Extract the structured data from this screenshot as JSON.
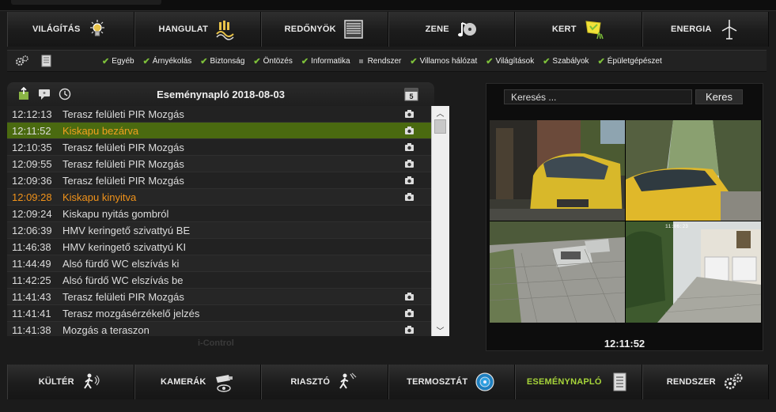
{
  "top_nav": [
    {
      "label": "VILÁGÍTÁS",
      "icon": "lightbulb-icon"
    },
    {
      "label": "HANGULAT",
      "icon": "mood-icon"
    },
    {
      "label": "REDŐNYÖK",
      "icon": "shutter-icon"
    },
    {
      "label": "ZENE",
      "icon": "music-icon"
    },
    {
      "label": "KERT",
      "icon": "garden-icon"
    },
    {
      "label": "ENERGIA",
      "icon": "wind-turbine-icon"
    }
  ],
  "filters": [
    {
      "label": "Egyéb",
      "checked": true
    },
    {
      "label": "Árnyékolás",
      "checked": true
    },
    {
      "label": "Biztonság",
      "checked": true
    },
    {
      "label": "Öntözés",
      "checked": true
    },
    {
      "label": "Informatika",
      "checked": true
    },
    {
      "label": "Rendszer",
      "checked": false
    },
    {
      "label": "Villamos hálózat",
      "checked": true
    },
    {
      "label": "Világítások",
      "checked": true
    },
    {
      "label": "Szabályok",
      "checked": true
    },
    {
      "label": "Épületgépészet",
      "checked": true
    }
  ],
  "log": {
    "title": "Eseménynapló 2018-08-03",
    "calendar_day": "5",
    "rows": [
      {
        "time": "12:12:13",
        "msg": "Terasz felületi PIR Mozgás",
        "cam": true,
        "style": "normal"
      },
      {
        "time": "12:11:52",
        "msg": "Kiskapu bezárva",
        "cam": true,
        "style": "selected"
      },
      {
        "time": "12:10:35",
        "msg": "Terasz felületi PIR Mozgás",
        "cam": true,
        "style": "normal"
      },
      {
        "time": "12:09:55",
        "msg": "Terasz felületi PIR Mozgás",
        "cam": true,
        "style": "normal"
      },
      {
        "time": "12:09:36",
        "msg": "Terasz felületi PIR Mozgás",
        "cam": true,
        "style": "normal"
      },
      {
        "time": "12:09:28",
        "msg": "Kiskapu kinyitva",
        "cam": true,
        "style": "orange"
      },
      {
        "time": "12:09:24",
        "msg": "Kiskapu nyitás gombról",
        "cam": false,
        "style": "normal"
      },
      {
        "time": "12:06:39",
        "msg": "HMV keringető szivattyú BE",
        "cam": false,
        "style": "normal"
      },
      {
        "time": "11:46:38",
        "msg": "HMV keringető szivattyú KI",
        "cam": false,
        "style": "normal"
      },
      {
        "time": "11:44:49",
        "msg": "Alsó fürdő WC elszívás ki",
        "cam": false,
        "style": "normal"
      },
      {
        "time": "11:42:25",
        "msg": "Alsó fürdő WC elszívás be",
        "cam": false,
        "style": "normal"
      },
      {
        "time": "11:41:43",
        "msg": "Terasz felületi PIR Mozgás",
        "cam": true,
        "style": "normal"
      },
      {
        "time": "11:41:41",
        "msg": "Terasz mozgásérzékelő jelzés",
        "cam": true,
        "style": "normal"
      },
      {
        "time": "11:41:38",
        "msg": "Mozgás a teraszon",
        "cam": true,
        "style": "normal"
      }
    ]
  },
  "brand": "i-Control",
  "search": {
    "placeholder": "Keresés ...",
    "button": "Keres"
  },
  "camera_time": "12:11:52",
  "camera_stamp": "11:06:23",
  "bottom_nav": [
    {
      "label": "KÜLTÉR",
      "icon": "outdoor-motion-icon",
      "active": false
    },
    {
      "label": "KAMERÁK",
      "icon": "camera-icon",
      "active": false
    },
    {
      "label": "RIASZTÓ",
      "icon": "alarm-icon",
      "active": false
    },
    {
      "label": "TERMOSZTÁT",
      "icon": "thermostat-icon",
      "active": false
    },
    {
      "label": "ESEMÉNYNAPLÓ",
      "icon": "event-log-icon",
      "active": true
    },
    {
      "label": "RENDSZER",
      "icon": "gears-icon",
      "active": false
    }
  ]
}
